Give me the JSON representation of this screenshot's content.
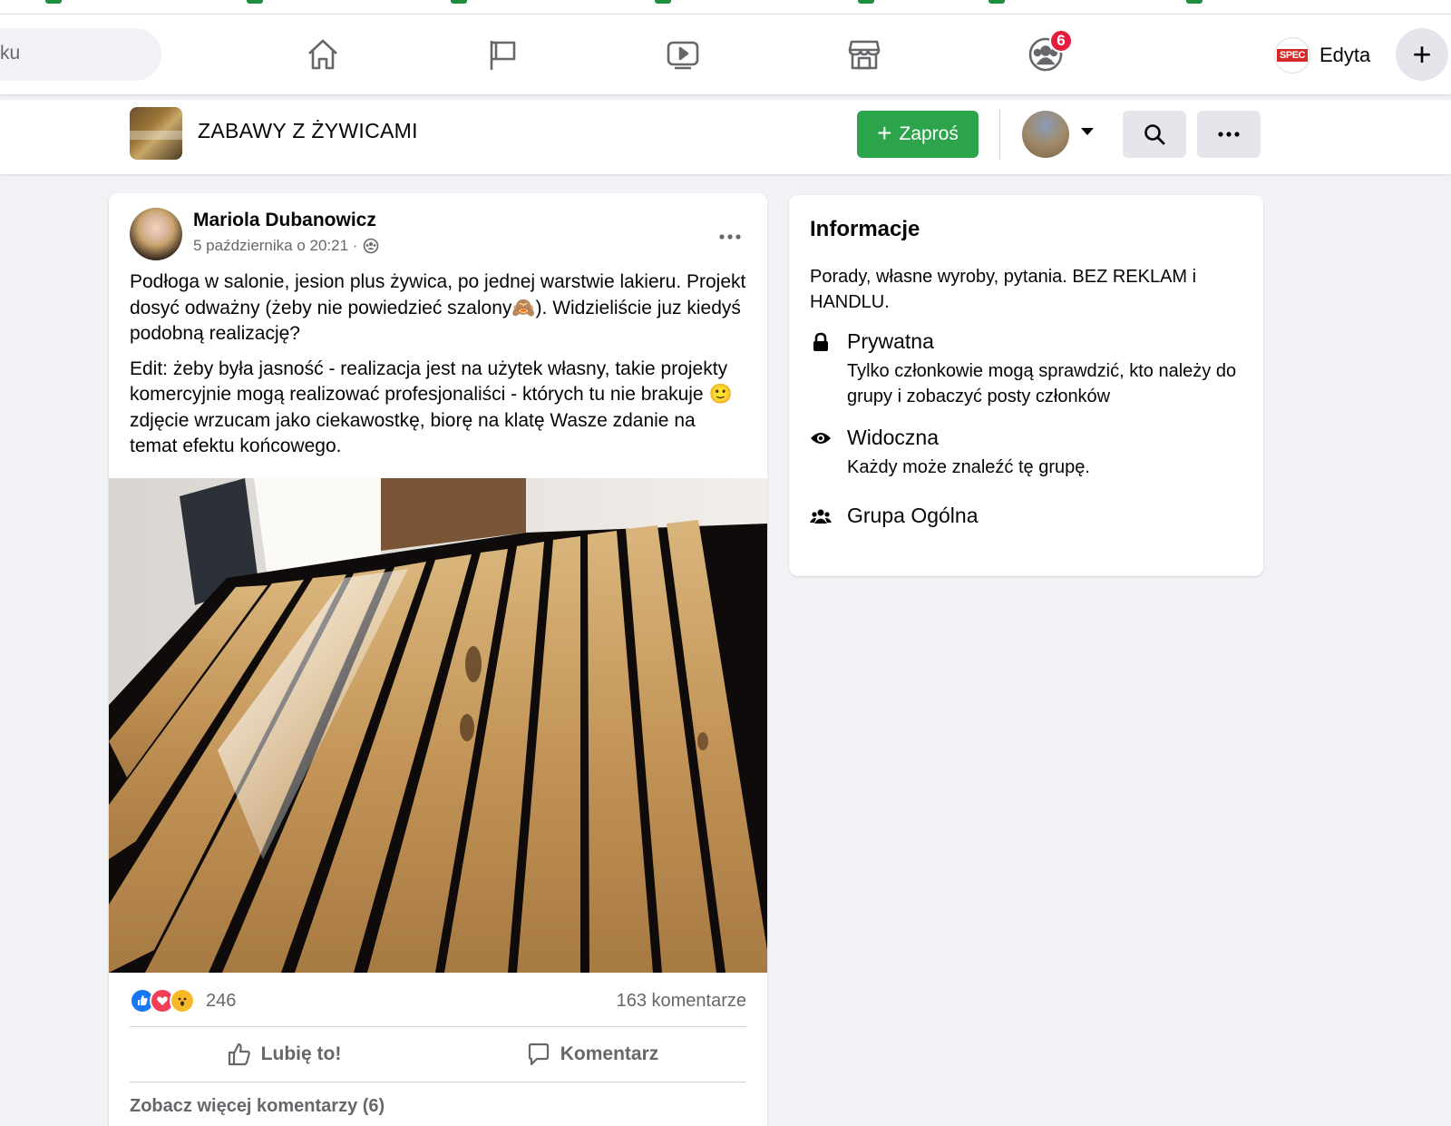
{
  "browser": {
    "bookmark_count": 7
  },
  "topnav": {
    "search": {
      "value": "ku"
    },
    "nav_icons": [
      "home-icon",
      "pages-flag-icon",
      "watch-icon",
      "marketplace-icon",
      "groups-icon"
    ],
    "groups_badge": "6",
    "profile_name": "Edyta",
    "profile_logo_text": "SPEC",
    "create_symbol": "+"
  },
  "group_header": {
    "title": "ZABAWY Z ŻYWICAMI",
    "invite_label": "Zaproś",
    "invite_color": "#2ca44c"
  },
  "post": {
    "author": "Mariola Dubanowicz",
    "timestamp": "5 października o 20:21 ·",
    "paragraphs": [
      "Podłoga w salonie, jesion plus żywica, po jednej warstwie lakieru. Projekt dosyć odważny (żeby nie powiedzieć szalony🙈). Widzieliście juz kiedyś podobną realizację?",
      "Edit: żeby była jasność - realizacja jest na użytek własny, takie projekty komercyjnie mogą realizować profesjonaliści - których tu nie brakuje 🙂 zdjęcie wrzucam jako ciekawostkę, biorę na klatę Wasze zdanie na temat efektu końcowego."
    ],
    "reaction_count": "246",
    "comments_count": "163 komentarze",
    "like_label": "Lubię to!",
    "comment_label": "Komentarz",
    "more_comments": "Zobacz więcej komentarzy (6)"
  },
  "info": {
    "title": "Informacje",
    "description": "Porady, własne wyroby, pytania. BEZ REKLAM i HANDLU.",
    "items": [
      {
        "icon": "lock-icon",
        "title": "Prywatna",
        "subtitle": "Tylko członkowie mogą sprawdzić, kto należy do grupy i zobaczyć posty członków"
      },
      {
        "icon": "eye-icon",
        "title": "Widoczna",
        "subtitle": "Każdy może znaleźć tę grupę."
      },
      {
        "icon": "people-icon",
        "title": "Grupa Ogólna",
        "subtitle": ""
      }
    ]
  },
  "colors": {
    "fb_blue": "#1877f2",
    "badge_red": "#e41e3f",
    "invite_green": "#2ca44c",
    "resin_black": "#0e0b0a",
    "ash_wood": "#c49a5c"
  }
}
